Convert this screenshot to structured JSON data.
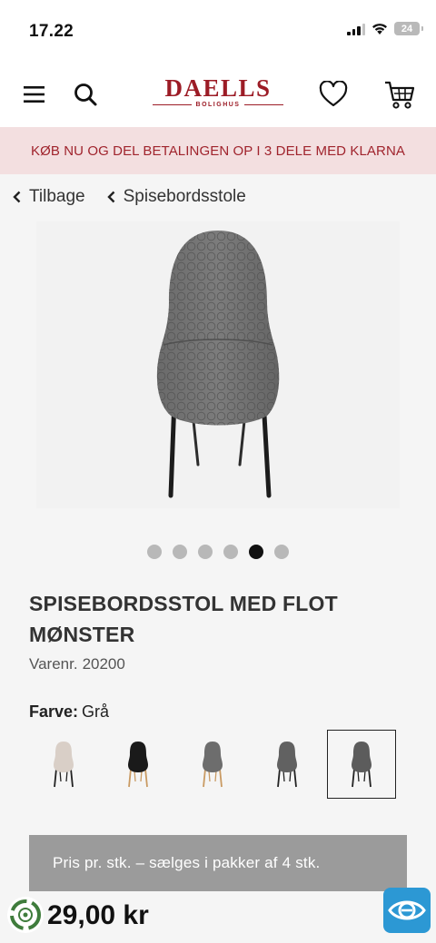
{
  "status_bar": {
    "time": "17.22",
    "battery": "24"
  },
  "header": {
    "logo_main": "DAELLS",
    "logo_sub": "BOLIGHUS",
    "menu_icon": "menu-icon",
    "search_icon": "search-icon",
    "wishlist_icon": "heart-icon",
    "cart_icon": "cart-icon"
  },
  "promo": {
    "text": "KØB NU OG DEL BETALINGEN OP I 3 DELE MED KLARNA"
  },
  "breadcrumbs": [
    {
      "label": "Tilbage"
    },
    {
      "label": "Spisebordsstole"
    }
  ],
  "gallery": {
    "total": 6,
    "active_index": 4
  },
  "product": {
    "title": "SPISEBORDSSTOL MED FLOT MØNSTER",
    "sku_label": "Varenr.",
    "sku": "20200",
    "color_label": "Farve:",
    "color_value": "Grå",
    "info": "Pris pr. stk. – sælges i pakker af 4 stk.",
    "price": "29,00 kr"
  },
  "swatches": [
    {
      "seat": "#d9cfc7",
      "legs": "#222222",
      "selected": false
    },
    {
      "seat": "#1a1a1a",
      "legs": "#c99a62",
      "selected": false
    },
    {
      "seat": "#6d6d6d",
      "legs": "#c99a62",
      "selected": false
    },
    {
      "seat": "#616161",
      "legs": "#222222",
      "selected": false
    },
    {
      "seat": "#5c5c5c",
      "legs": "#222222",
      "selected": true
    }
  ],
  "colors": {
    "brand": "#9c1c26",
    "promo_bg": "#f3dfe0",
    "info_bg": "#9b9b9b",
    "badge_blue": "#2c98d4"
  }
}
